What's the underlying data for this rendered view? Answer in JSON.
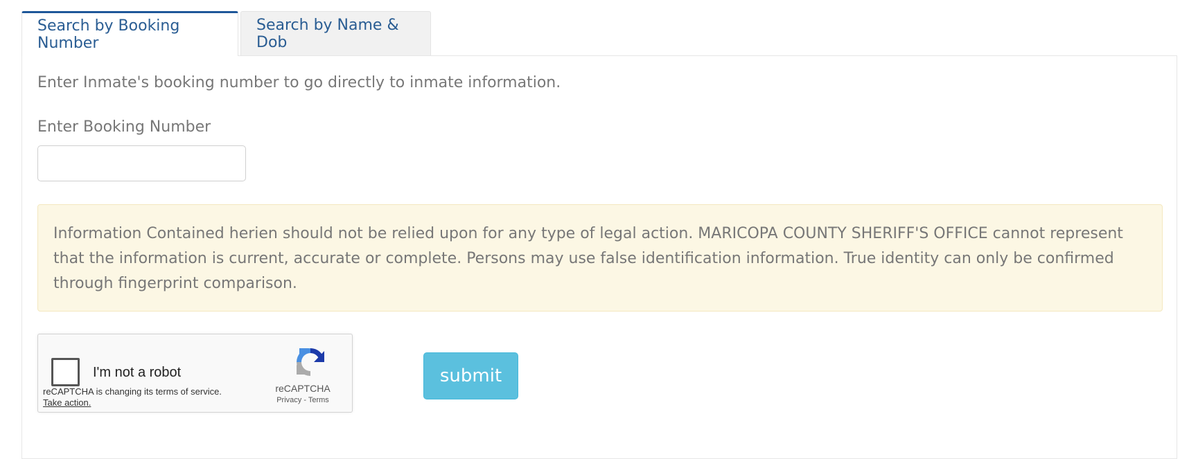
{
  "tabs": [
    {
      "label": "Search by Booking Number",
      "active": true
    },
    {
      "label": "Search by Name & Dob",
      "active": false
    }
  ],
  "panel": {
    "intro": "Enter Inmate's booking number to go directly to inmate information.",
    "booking_label": "Enter Booking Number",
    "booking_value": "",
    "notice": "Information Contained herien should not be relied upon for any type of legal action. MARICOPA COUNTY SHERIFF'S OFFICE cannot represent that the information is current, accurate or complete. Persons may use false identification information. True identity can only be confirmed through fingerprint comparison."
  },
  "captcha": {
    "checkbox_label": "I'm not a robot",
    "terms_notice": "reCAPTCHA is changing its terms of service.",
    "take_action": "Take action.",
    "brand": "reCAPTCHA",
    "privacy": "Privacy",
    "separator": " - ",
    "terms": "Terms",
    "logo_icon": "recaptcha-logo-icon"
  },
  "submit_label": "submit",
  "colors": {
    "tab_text": "#2a5d93",
    "active_tab_border": "#1e5799",
    "notice_bg": "#fcf7e4",
    "submit_bg": "#5bc0de",
    "body_text": "#777777"
  }
}
